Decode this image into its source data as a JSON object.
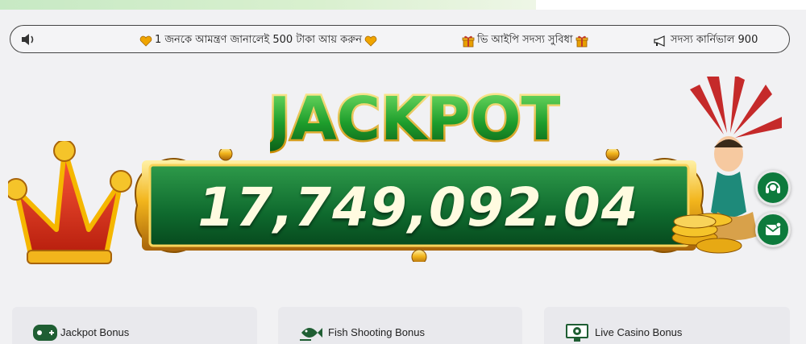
{
  "marquee": {
    "items": [
      {
        "icon": "heart-gold-icon",
        "text": "1 জনকে আমন্ত্রণ জানালেই 500 টাকা আয় করুন",
        "trail_icon": "heart-gold-icon"
      },
      {
        "icon": "gift-icon",
        "text": "ভি আইপি সদস্য সুবিধা",
        "trail_icon": "gift-icon"
      },
      {
        "icon": "megaphone-icon",
        "text": "সদস্য কার্নিভাল 900"
      }
    ]
  },
  "jackpot": {
    "title": "JACKPOT",
    "amount": "17,749,092.04"
  },
  "floating_buttons": [
    {
      "icon": "headset-icon"
    },
    {
      "icon": "mail-icon"
    }
  ],
  "bonus_cards": [
    {
      "icon": "gamepad-icon",
      "label": "Jackpot Bonus"
    },
    {
      "icon": "fish-icon",
      "label": "Fish Shooting Bonus"
    },
    {
      "icon": "live-casino-icon",
      "label": "Live Casino Bonus"
    }
  ],
  "colors": {
    "primary_green": "#0d7a3c",
    "gold": "#f5b700",
    "background": "#f1f1f3"
  }
}
